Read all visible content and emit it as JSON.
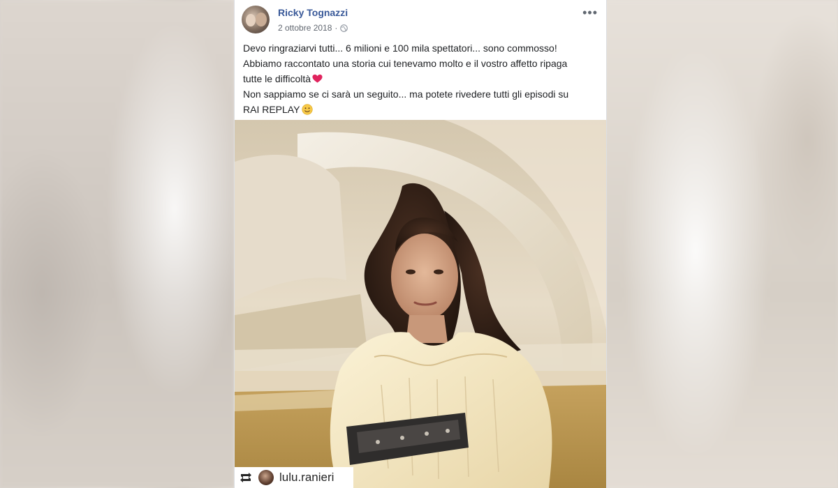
{
  "post": {
    "author": "Ricky Tognazzi",
    "date": "2 ottobre 2018",
    "privacy_icon": "globe-icon",
    "menu_icon": "more-options-icon",
    "menu_label": "•••",
    "text": {
      "line1": "Devo ringraziarvi tutti... 6 milioni e 100 mila spettatori... sono commosso!",
      "line2": "Abbiamo raccontato una storia cui tenevamo molto e il vostro affetto ripaga",
      "line3": "tutte le difficoltà",
      "line4": "Non sappiamo se ci sarà un seguito... ma potete rivedere tutti gli episodi su",
      "line5": "RAI REPLAY"
    },
    "emoji": {
      "heart": "heart-emoji",
      "smile": "smile-emoji"
    }
  },
  "photo": {
    "repost_icon": "repost-icon",
    "repost_user": "lulu.ranieri"
  },
  "colors": {
    "author_link": "#385898",
    "meta_text": "#616770",
    "body_text": "#1c1e21"
  }
}
